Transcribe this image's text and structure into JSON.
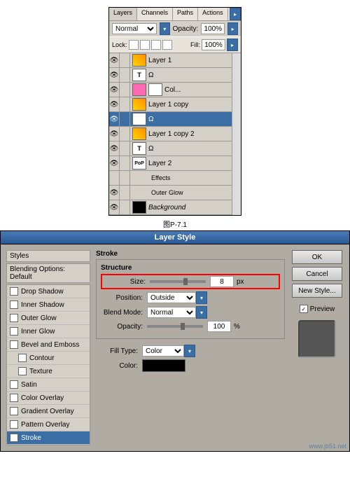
{
  "layers_panel": {
    "tabs": [
      "Layers",
      "Channels",
      "Paths",
      "Actions"
    ],
    "blend_mode": "Normal",
    "opacity_label": "Opacity:",
    "opacity_value": "100%",
    "lock_label": "Lock:",
    "fill_label": "Fill:",
    "fill_value": "100%",
    "layers": [
      {
        "name": "Layer 1",
        "thumb": "flower"
      },
      {
        "name": "Ω",
        "thumb": "txt",
        "text": "T"
      },
      {
        "name": "Col...",
        "thumb": "pink",
        "mask": true
      },
      {
        "name": "Layer 1 copy",
        "thumb": "flower"
      },
      {
        "name": "Ω",
        "thumb": "txt",
        "text": "T",
        "selected": true
      },
      {
        "name": "Layer 1 copy 2",
        "thumb": "flower"
      },
      {
        "name": "Ω",
        "thumb": "txt",
        "text": "T"
      },
      {
        "name": "Layer 2",
        "thumb": "pop",
        "text": "PoP"
      },
      {
        "name": "Effects",
        "sub": true
      },
      {
        "name": "Outer Glow",
        "sub": true,
        "eye": true
      },
      {
        "name": "Background",
        "thumb": "bg",
        "italic": true
      }
    ],
    "caption": "图P-7.1"
  },
  "layer_style": {
    "title": "Layer Style",
    "styles_header": "Styles",
    "blending_header": "Blending Options: Default",
    "options": [
      {
        "label": "Drop Shadow",
        "checked": false
      },
      {
        "label": "Inner Shadow",
        "checked": false
      },
      {
        "label": "Outer Glow",
        "checked": false
      },
      {
        "label": "Inner Glow",
        "checked": false
      },
      {
        "label": "Bevel and Emboss",
        "checked": false
      },
      {
        "label": "Contour",
        "checked": false,
        "indent": true
      },
      {
        "label": "Texture",
        "checked": false,
        "indent": true
      },
      {
        "label": "Satin",
        "checked": false
      },
      {
        "label": "Color Overlay",
        "checked": false
      },
      {
        "label": "Gradient Overlay",
        "checked": false
      },
      {
        "label": "Pattern Overlay",
        "checked": false
      },
      {
        "label": "Stroke",
        "checked": true,
        "selected": true
      }
    ],
    "section_title": "Stroke",
    "structure_title": "Structure",
    "size_label": "Size:",
    "size_value": "8",
    "size_unit": "px",
    "position_label": "Position:",
    "position_value": "Outside",
    "blendmode_label": "Blend Mode:",
    "blendmode_value": "Normal",
    "opacity_label": "Opacity:",
    "opacity_value": "100",
    "opacity_unit": "%",
    "filltype_label": "Fill Type:",
    "filltype_value": "Color",
    "color_label": "Color:",
    "color_value": "#000000",
    "buttons": {
      "ok": "OK",
      "cancel": "Cancel",
      "new_style": "New Style..."
    },
    "preview_label": "Preview",
    "preview_checked": true
  },
  "watermark": "www.jb51.net"
}
